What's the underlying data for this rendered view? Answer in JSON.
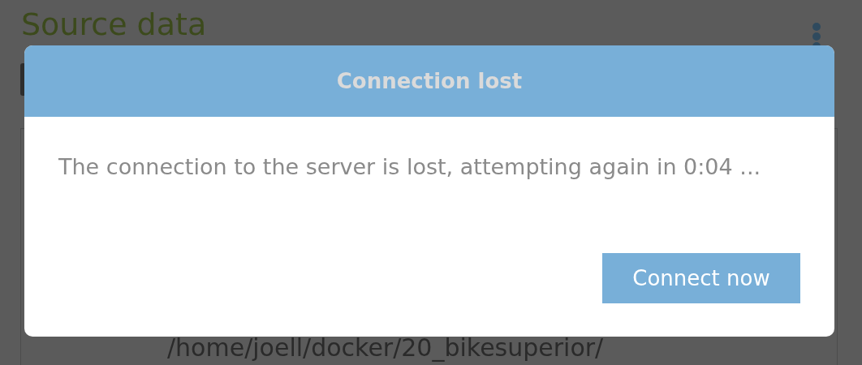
{
  "page": {
    "title": "Source data",
    "path": "/home/joell/docker/20_bikesuperior/"
  },
  "dialog": {
    "title": "Connection lost",
    "message": "The connection to the server is lost, attempting again in 0:04 ...",
    "button": "Connect now"
  }
}
